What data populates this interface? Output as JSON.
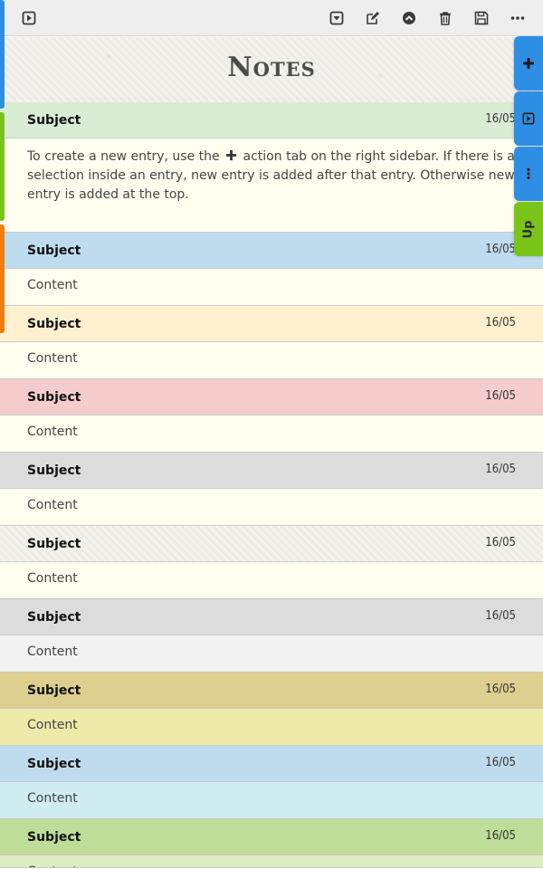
{
  "app": {
    "title": "Notes"
  },
  "toolbar": {
    "buttons": [
      {
        "icon": "play-square-icon",
        "name": "preview-button"
      },
      {
        "icon": "caret-down-square-icon",
        "name": "collapse-button"
      },
      {
        "icon": "edit-icon",
        "name": "edit-button"
      },
      {
        "icon": "chevron-up-circle-icon",
        "name": "move-up-button"
      },
      {
        "icon": "trash-icon",
        "name": "delete-button"
      },
      {
        "icon": "save-icon",
        "name": "save-button"
      },
      {
        "icon": "more-icon",
        "name": "more-button"
      }
    ]
  },
  "sidebar_tabs": [
    {
      "name": "add-entry-tab",
      "icon": "plus-icon",
      "color": "#2e8ee3"
    },
    {
      "name": "preview-tab",
      "icon": "play-square-icon",
      "color": "#2e8ee3"
    },
    {
      "name": "more-tab",
      "icon": "vertical-ellipsis-icon",
      "color": "#2e8ee3"
    },
    {
      "name": "up-tab",
      "label": "Up",
      "color": "#7ac41a"
    }
  ],
  "entries": [
    {
      "subject": "Subject",
      "date": "16/05",
      "content_before": "To create a new entry, use the",
      "content_after": "action tab on the right sidebar. If there is a selection inside an entry, new entry is added after that entry. Otherwise new entry is added at the top.",
      "head_color": "#d9ecd4",
      "body_color": "#fffff0"
    },
    {
      "subject": "Subject",
      "date": "16/05",
      "content": "Content",
      "head_color": "#bfdcef",
      "body_color": "#fffff0"
    },
    {
      "subject": "Subject",
      "date": "16/05",
      "content": "Content",
      "head_color": "#fff0cf",
      "body_color": "#fffff0"
    },
    {
      "subject": "Subject",
      "date": "16/05",
      "content": "Content",
      "head_color": "#f5cccc",
      "body_color": "#fffff0"
    },
    {
      "subject": "Subject",
      "date": "16/05",
      "content": "Content",
      "head_color": "#dcdcdc",
      "body_color": "#fffff0"
    },
    {
      "subject": "Subject",
      "date": "16/05",
      "content": "Content",
      "head_color": "textured",
      "body_color": "#fffff0"
    },
    {
      "subject": "Subject",
      "date": "16/05",
      "content": "Content",
      "head_color": "#dcdcdc",
      "body_color": "#f2f2f2"
    },
    {
      "subject": "Subject",
      "date": "16/05",
      "content": "Content",
      "head_color": "#ddd08f",
      "body_color": "#eeeaaa"
    },
    {
      "subject": "Subject",
      "date": "16/05",
      "content": "Content",
      "head_color": "#bfdcef",
      "body_color": "#cfecf1"
    },
    {
      "subject": "Subject",
      "date": "16/05",
      "content": "Content",
      "head_color": "#bddd99",
      "body_color": "#dfedc3"
    }
  ]
}
